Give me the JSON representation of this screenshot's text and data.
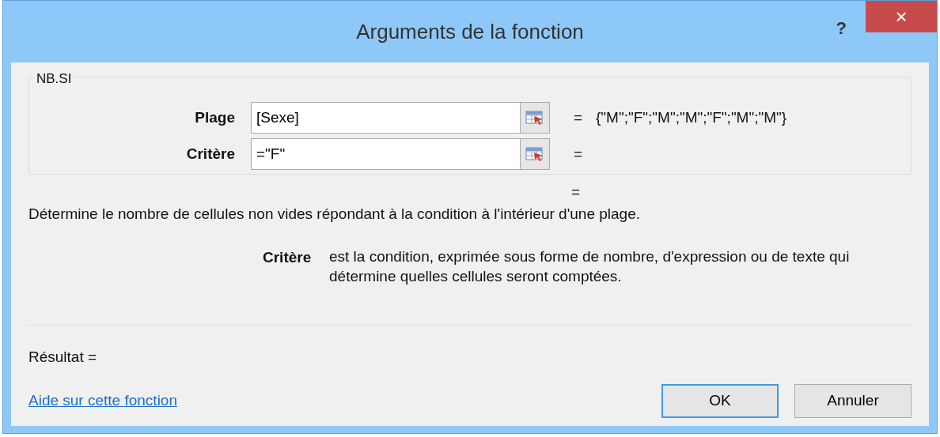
{
  "window": {
    "title": "Arguments de la fonction",
    "help": "?",
    "close": "×"
  },
  "function_group": {
    "name": "NB.SI",
    "arguments": [
      {
        "label": "Plage",
        "value": "[Sexe]",
        "equals": "=",
        "result": "{\"M\";\"F\";\"M\";\"M\";\"F\";\"M\";\"M\"}"
      },
      {
        "label": "Critère",
        "value": "=\"F\"",
        "equals": "="
      }
    ]
  },
  "formula_equals": "=",
  "description": "Détermine le nombre de cellules non vides répondant à la condition à l'intérieur d'une plage.",
  "parameter_help": {
    "name": "Critère",
    "text": "est la condition, exprimée sous forme de nombre, d'expression ou de texte qui détermine quelles cellules seront comptées."
  },
  "result_label": "Résultat =",
  "help_link": "Aide sur cette fonction",
  "buttons": [
    {
      "label": "OK",
      "default": true
    },
    {
      "label": "Annuler",
      "default": false
    }
  ]
}
